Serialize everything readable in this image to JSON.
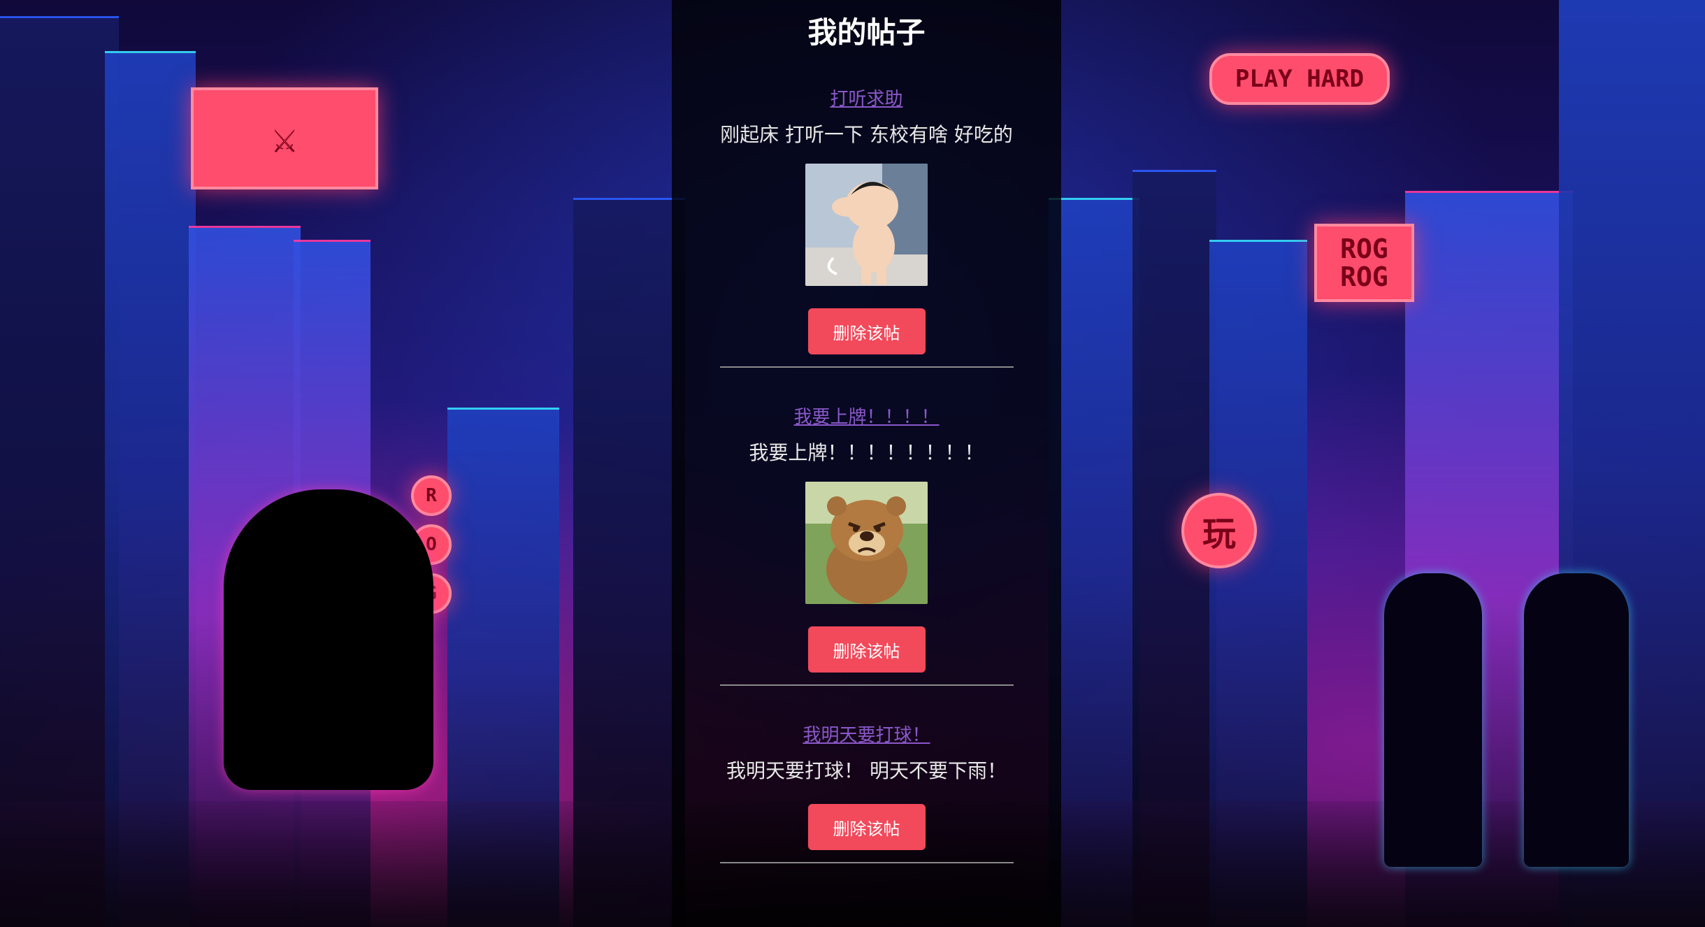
{
  "page": {
    "title": "我的帖子"
  },
  "background": {
    "signs": {
      "play_hard": "PLAY HARD",
      "rog_1": "ROG",
      "rog_2": "ROG",
      "wan": "玩",
      "vertical": [
        "R",
        "O",
        "G"
      ]
    },
    "colors": {
      "neon_pink": "#ff3aa0",
      "neon_cyan": "#36e0ff",
      "city_blue": "#2040c0"
    }
  },
  "posts": [
    {
      "title": "打听求助",
      "body": "刚起床 打听一下 东校有啥 好吃的",
      "image": "cartoon-boy-image",
      "delete_label": "删除该帖"
    },
    {
      "title": "我要上牌！！！！",
      "body": "我要上牌！！！！！！！！",
      "image": "cartoon-bear-image",
      "delete_label": "删除该帖"
    },
    {
      "title": "我明天要打球！",
      "body": "我明天要打球！  明天不要下雨！",
      "image": null,
      "delete_label": "删除该帖"
    }
  ],
  "colors": {
    "link": "#8a58c9",
    "delete_button": "#f2495b",
    "panel": "rgba(0,0,0,0.78)"
  }
}
